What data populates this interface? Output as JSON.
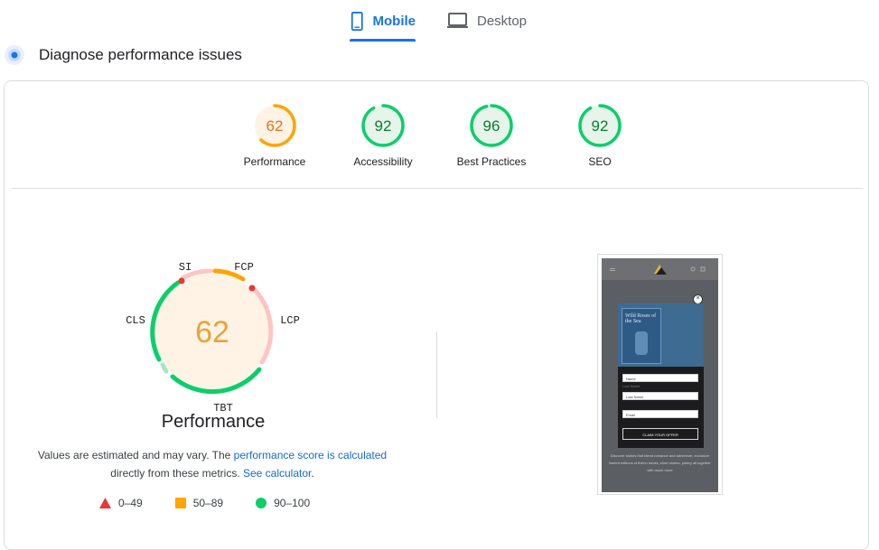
{
  "tabs": {
    "mobile": "Mobile",
    "desktop": "Desktop"
  },
  "section": {
    "title": "Diagnose performance issues"
  },
  "scores": [
    {
      "value": 62,
      "label": "Performance",
      "color": "#e8711a",
      "fill": "#fff3e6",
      "ring": "#ffa400"
    },
    {
      "value": 92,
      "label": "Accessibility",
      "color": "#0c7d32",
      "fill": "#e6f4ea",
      "ring": "#0cce6b"
    },
    {
      "value": 96,
      "label": "Best Practices",
      "color": "#0c7d32",
      "fill": "#e6f4ea",
      "ring": "#0cce6b"
    },
    {
      "value": 92,
      "label": "SEO",
      "color": "#0c7d32",
      "fill": "#e6f4ea",
      "ring": "#0cce6b"
    }
  ],
  "performance": {
    "score": 62,
    "title": "Performance",
    "metrics": {
      "si": "SI",
      "fcp": "FCP",
      "lcp": "LCP",
      "tbt": "TBT",
      "cls": "CLS"
    },
    "note_prefix": "Values are estimated and may vary. The ",
    "note_link": "performance score is calculated",
    "note_middle": " directly from these metrics. ",
    "note_link2": "See calculator",
    "note_suffix": "."
  },
  "legend": [
    {
      "range": "0–49",
      "shape": "triangle",
      "color": "#f33"
    },
    {
      "range": "50–89",
      "shape": "square",
      "color": "#ffa400"
    },
    {
      "range": "90–100",
      "shape": "circle",
      "color": "#0cce6b"
    }
  ],
  "screenshot": {
    "book_title": "Wild Roses of the Sea",
    "field_name": "Name",
    "field_hint": "Last Name",
    "field_last": "Last Name",
    "field_email": "Email",
    "cta": "CLAIM YOUR OFFER",
    "body_text": "Discover stories that blend romance and adventure, exclusive limited editions of fiction books, short stories, poetry all together with much more"
  }
}
